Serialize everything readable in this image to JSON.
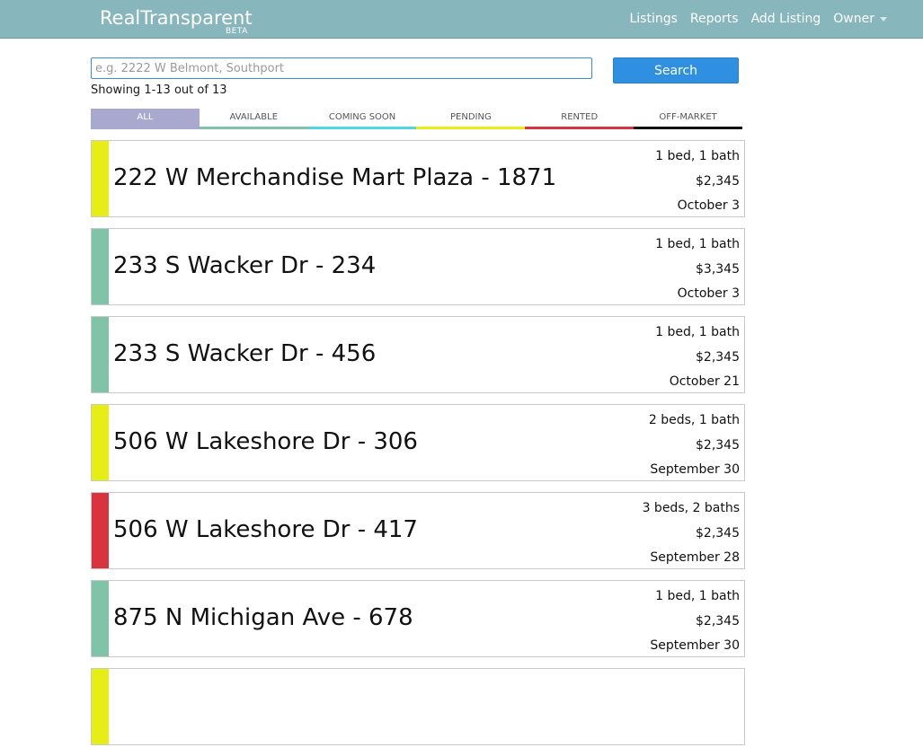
{
  "header": {
    "brand": "RealTransparent",
    "beta": "BETA",
    "nav": {
      "listings": "Listings",
      "reports": "Reports",
      "add_listing": "Add Listing",
      "owner": "Owner"
    }
  },
  "search": {
    "placeholder": "e.g. 2222 W Belmont, Southport",
    "value": "",
    "button_label": "Search",
    "showing_text": "Showing 1-13 out of 13"
  },
  "tabs": [
    {
      "label": "ALL",
      "color": "#a9a9cf",
      "active": true
    },
    {
      "label": "AVAILABLE",
      "color": "#7fc3a8",
      "active": false
    },
    {
      "label": "COMING SOON",
      "color": "#4fd6e6",
      "active": false
    },
    {
      "label": "PENDING",
      "color": "#e6ee16",
      "active": false
    },
    {
      "label": "RENTED",
      "color": "#d8333f",
      "active": false
    },
    {
      "label": "OFF-MARKET",
      "color": "#111111",
      "active": false
    }
  ],
  "listings": [
    {
      "address": "222 W Merchandise Mart Plaza - 1871",
      "beds_baths": "1 bed, 1 bath",
      "price": "$2,345",
      "date": "October 3",
      "status_color": "#e6ee16"
    },
    {
      "address": "233 S Wacker Dr - 234",
      "beds_baths": "1 bed, 1 bath",
      "price": "$3,345",
      "date": "October 3",
      "status_color": "#7fc3a8"
    },
    {
      "address": "233 S Wacker Dr - 456",
      "beds_baths": "1 bed, 1 bath",
      "price": "$2,345",
      "date": "October 21",
      "status_color": "#7fc3a8"
    },
    {
      "address": "506 W Lakeshore Dr - 306",
      "beds_baths": "2 beds, 1 bath",
      "price": "$2,345",
      "date": "September 30",
      "status_color": "#e6ee16"
    },
    {
      "address": "506 W Lakeshore Dr - 417",
      "beds_baths": "3 beds, 2 baths",
      "price": "$2,345",
      "date": "September 28",
      "status_color": "#d8333f"
    },
    {
      "address": "875 N Michigan Ave - 678",
      "beds_baths": "1 bed, 1 bath",
      "price": "$2,345",
      "date": "September 30",
      "status_color": "#7fc3a8"
    },
    {
      "address": "",
      "beds_baths": "",
      "price": "",
      "date": "",
      "status_color": "#e6ee16"
    }
  ]
}
